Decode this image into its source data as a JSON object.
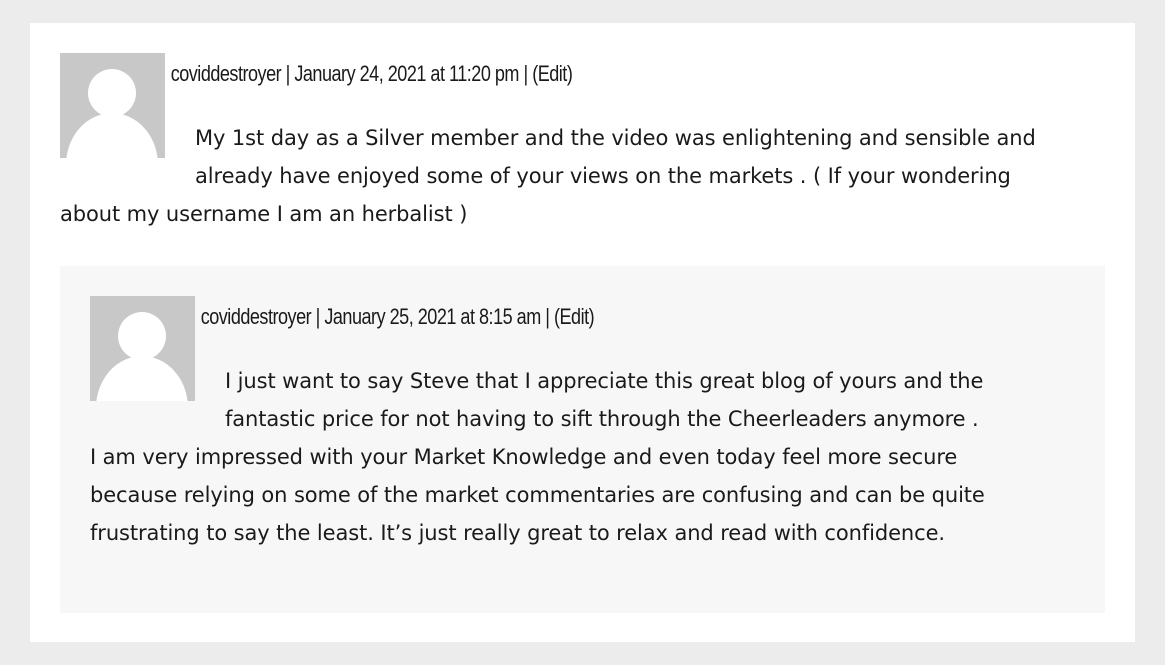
{
  "comments": [
    {
      "author": "coviddestroyer",
      "separator1": " | ",
      "date": "January 24, 2021 at 11:20 pm",
      "separator2": " | ",
      "edit_label": "(Edit)",
      "avatar_icon": "default-avatar-icon",
      "paragraphs": [
        "My 1st day as a Silver member and the video was enlightening and sensible and already have enjoyed some of your views on the markets . ( If your wondering about my username I am an herbalist )"
      ]
    },
    {
      "author": "coviddestroyer",
      "separator1": " | ",
      "date": "January 25, 2021 at 8:15 am",
      "separator2": " | ",
      "edit_label": "(Edit)",
      "avatar_icon": "default-avatar-icon",
      "paragraphs": [
        "I just want to say Steve that I appreciate this great blog of yours and the fantastic price for not having to sift through the Cheerleaders anymore .",
        "I am very impressed with your Market Knowledge and even today feel more secure because relying on some of the market commentaries are confusing and can be quite frustrating to say the least. It’s just really great to relax and read with confidence."
      ]
    }
  ],
  "colors": {
    "page_background": "#ececec",
    "card_background": "#ffffff",
    "reply_background": "#f7f7f7",
    "avatar_background": "#c8c8c8",
    "avatar_silhouette": "#ffffff",
    "text": "#1a1a1a"
  }
}
